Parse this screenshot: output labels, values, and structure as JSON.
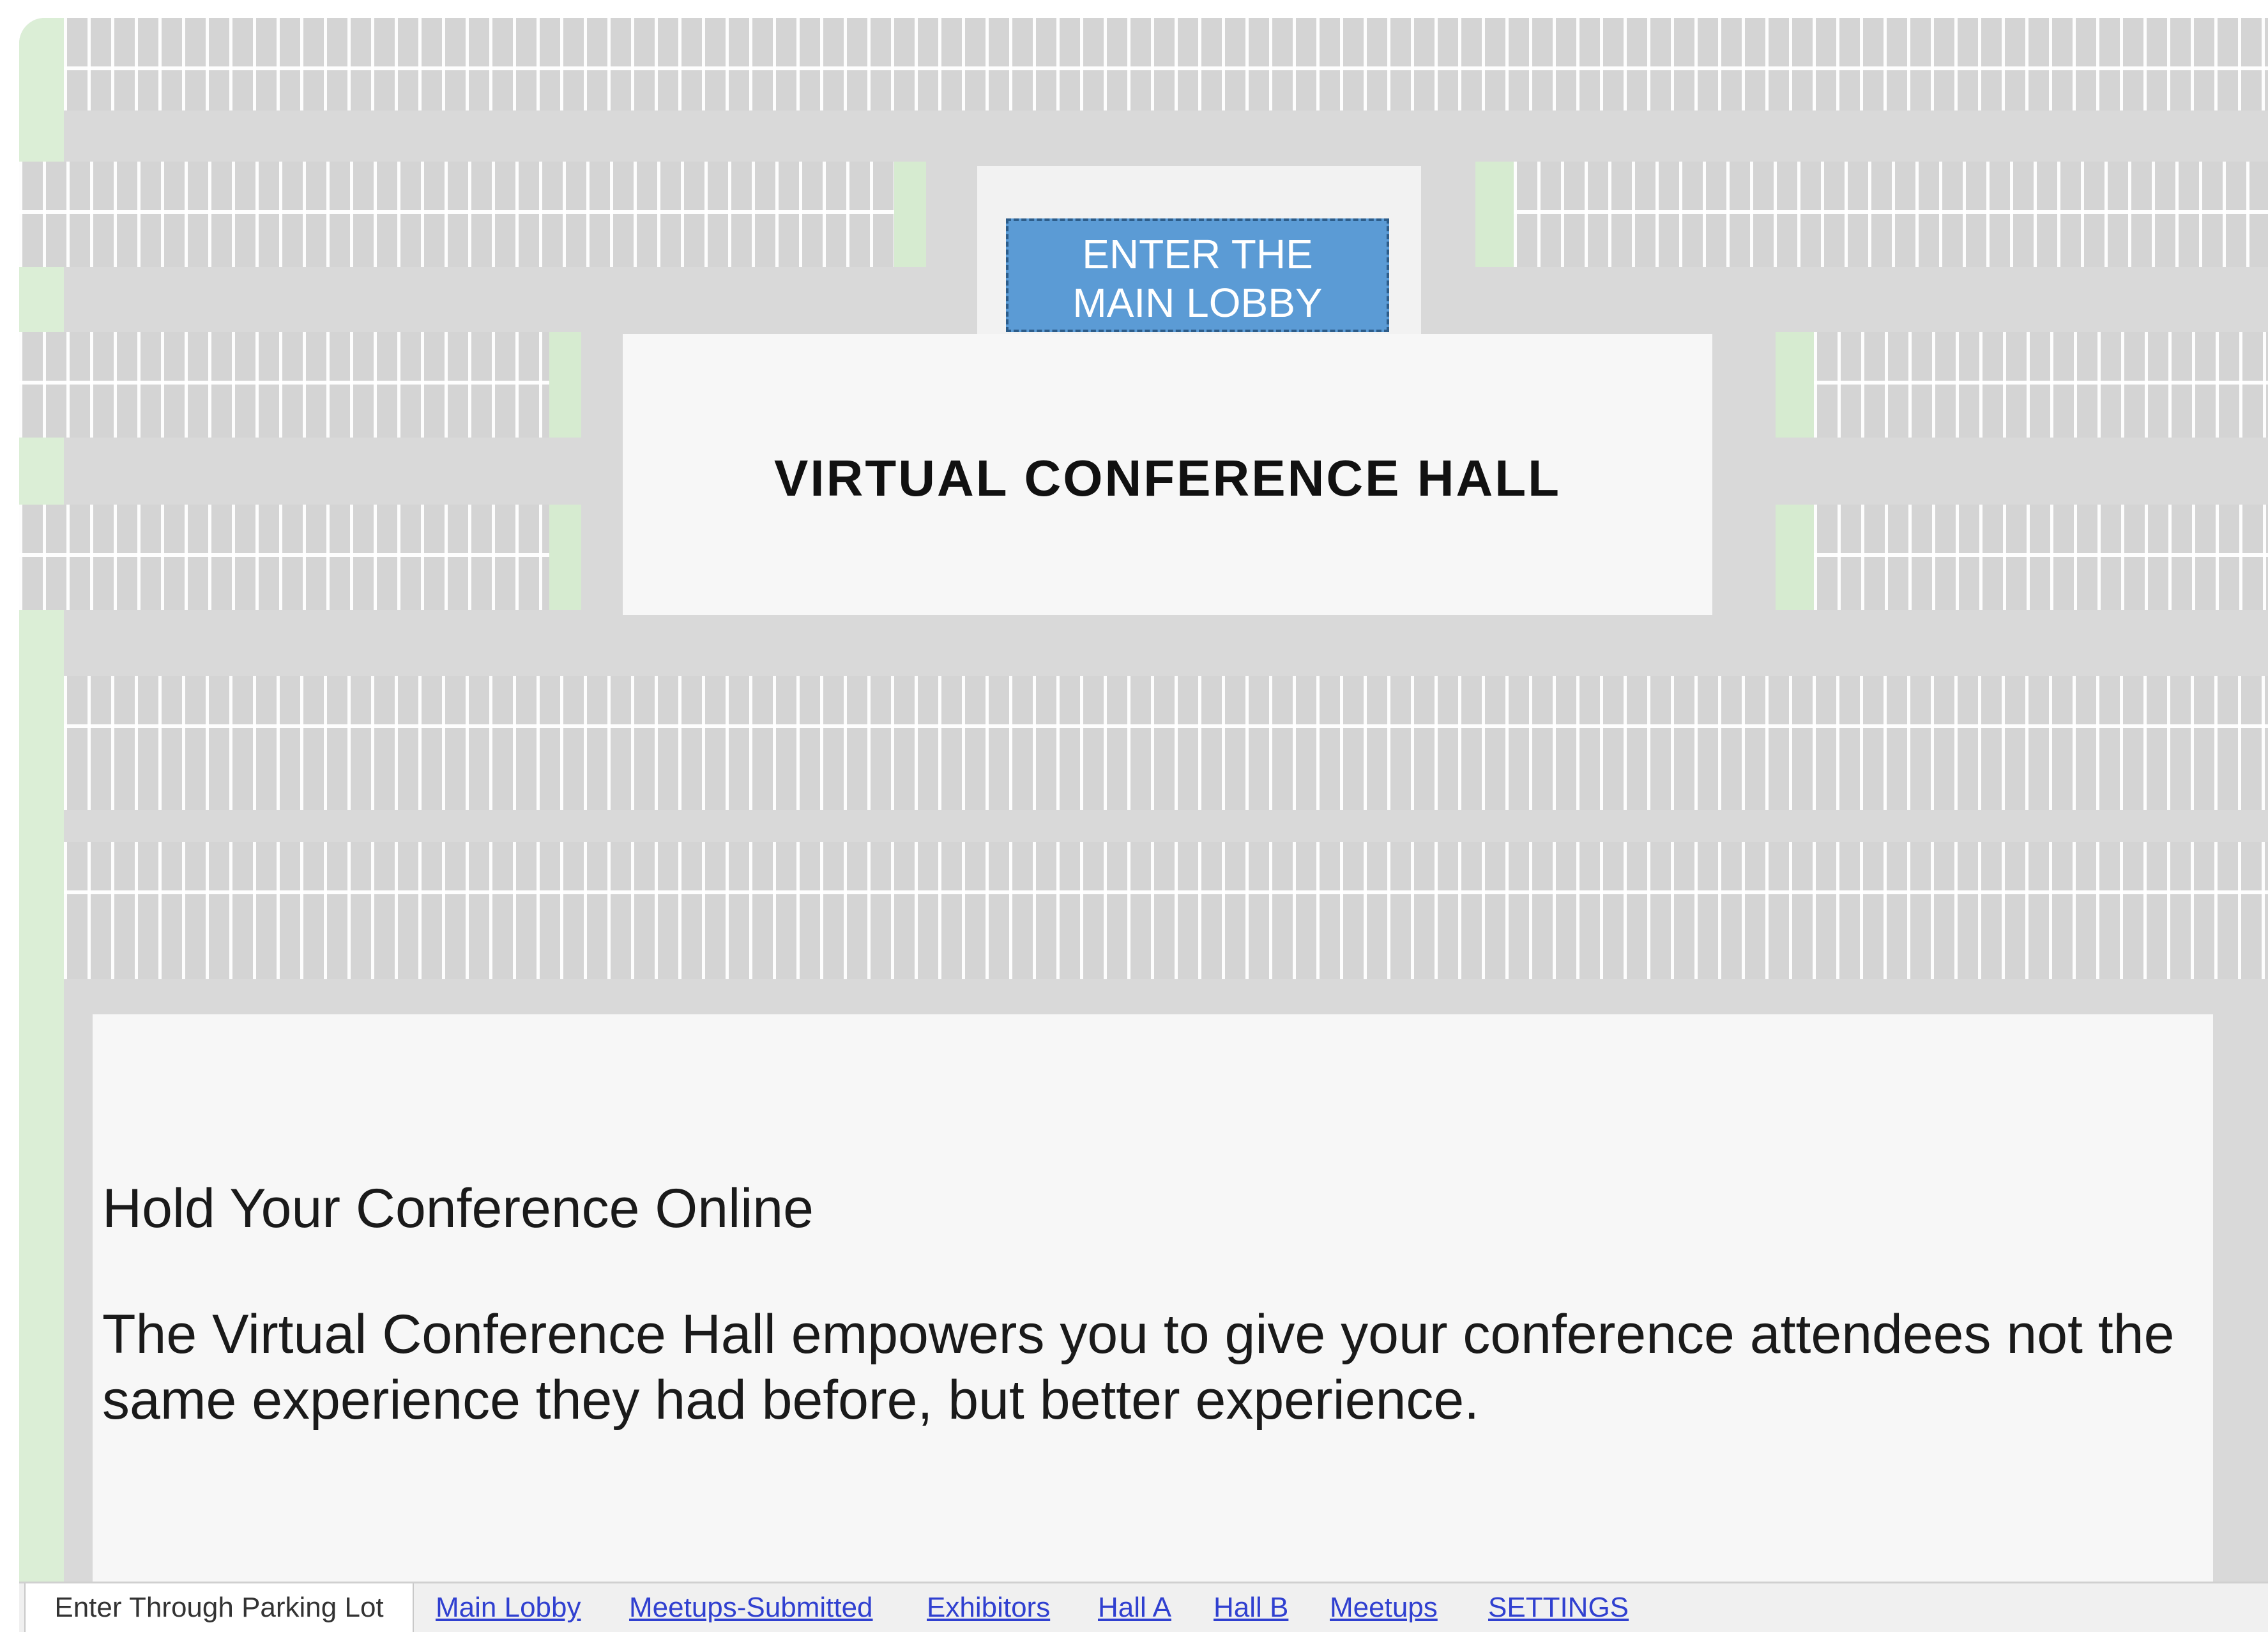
{
  "entrance": {
    "button_label_line1": "ENTER THE",
    "button_label_line2": "MAIN LOBBY"
  },
  "hall": {
    "title": "VIRTUAL CONFERENCE HALL"
  },
  "info": {
    "heading": "Hold Your Conference Online",
    "text": "The Virtual Conference Hall empowers you to give your conference attendees not the same experience they had before, but better experience."
  },
  "tabs": {
    "active": "Enter Through Parking Lot",
    "links": [
      "Main Lobby",
      "Meetups-Submitted",
      "Exhibitors",
      "Hall A",
      "Hall B",
      "Meetups",
      "SETTINGS"
    ]
  },
  "colors": {
    "button_blue": "#5b9bd5",
    "asphalt": "#d9d9d9",
    "grass": "#d6ebd0",
    "link": "#3040d0"
  }
}
